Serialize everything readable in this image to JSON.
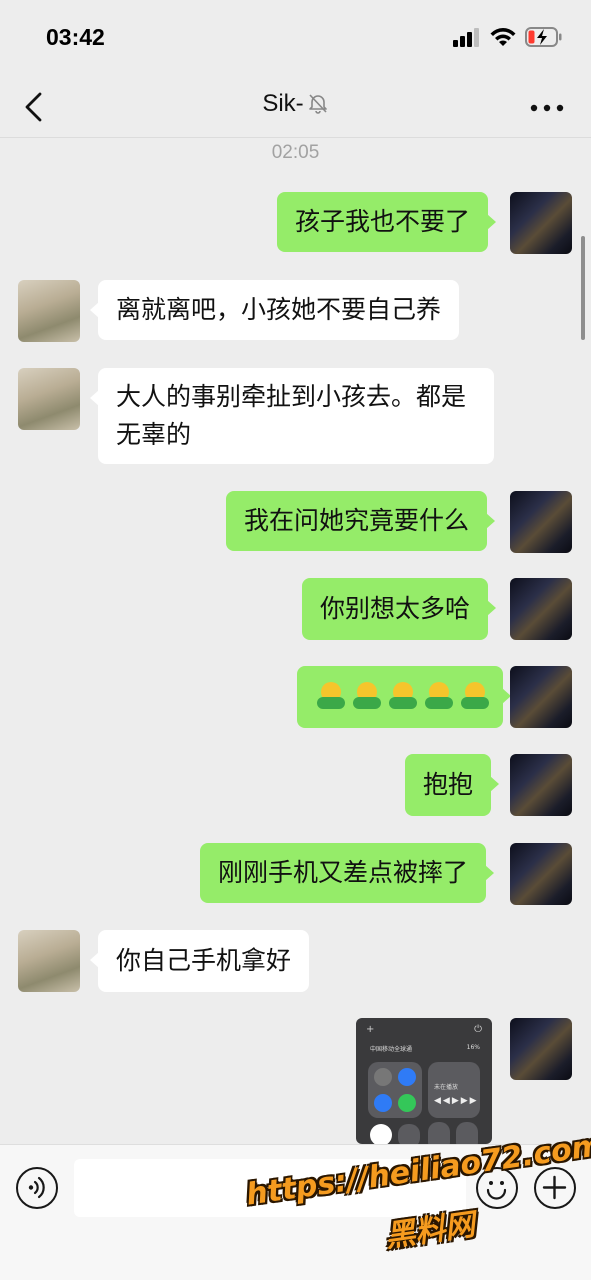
{
  "status_bar": {
    "time": "03:42"
  },
  "header": {
    "title": "Sik-"
  },
  "chat": {
    "timestamp": "02:05",
    "messages": [
      {
        "from": "me",
        "text": "孩子我也不要了"
      },
      {
        "from": "her",
        "text": "离就离吧，小孩她不要自己养"
      },
      {
        "from": "her",
        "line1": "大人的事别牵扯到小孩去。都是",
        "line2": "无辜的"
      },
      {
        "from": "me",
        "text": "我在问她究竟要什么"
      },
      {
        "from": "me",
        "text": "你别想太多哈"
      },
      {
        "from": "me",
        "emoji": "hug",
        "count": 5
      },
      {
        "from": "me",
        "text": "抱抱"
      },
      {
        "from": "me",
        "text": "刚刚手机又差点被摔了"
      },
      {
        "from": "her",
        "text": "你自己手机拿好"
      },
      {
        "from": "me",
        "image": "control-center-screenshot"
      }
    ]
  },
  "screenshot": {
    "carrier": "中国移动全球通",
    "battery": "16%",
    "now_playing": "未在播放"
  },
  "watermark": {
    "url": "https://heiliao72.com",
    "name": "黑料网"
  },
  "colors": {
    "outgoing_bubble": "#95ec69",
    "incoming_bubble": "#ffffff",
    "background": "#ededed"
  }
}
